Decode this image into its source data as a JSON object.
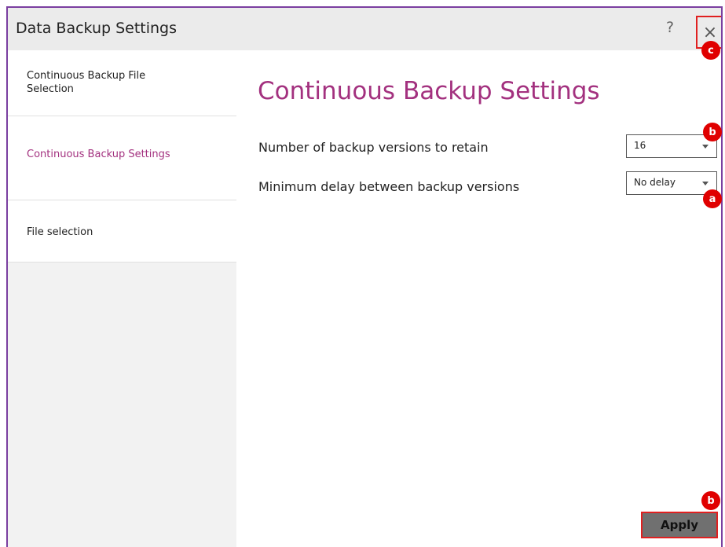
{
  "window": {
    "title": "Data Backup Settings",
    "help_label": "?",
    "close_label": "×"
  },
  "sidebar": {
    "items": [
      {
        "label_line1": "Continuous Backup File",
        "label_line2": "Selection",
        "active": false
      },
      {
        "label": "Continuous Backup Settings",
        "active": true
      },
      {
        "label": "File selection",
        "active": false
      }
    ]
  },
  "main": {
    "heading": "Continuous Backup Settings",
    "settings": [
      {
        "label": "Number of backup versions to retain",
        "value": "16"
      },
      {
        "label": "Minimum delay between backup versions",
        "value": "No delay"
      }
    ],
    "apply_label": "Apply"
  },
  "annotations": {
    "close_badge": "c",
    "versions_badge": "b",
    "delay_badge": "a",
    "apply_badge": "b"
  },
  "colors": {
    "accent": "#a3317f",
    "window_border": "#7a3fa0",
    "highlight": "#e02020",
    "badge": "#e00000"
  }
}
